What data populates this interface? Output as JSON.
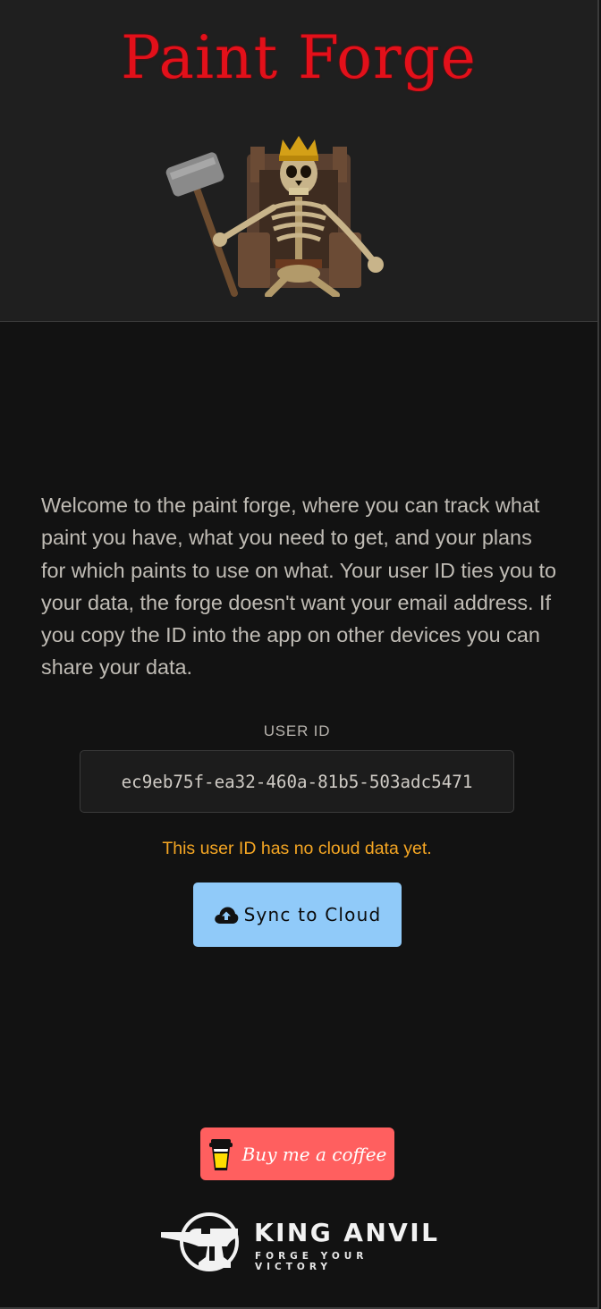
{
  "header": {
    "title": "Paint Forge",
    "hero_image": "crowned-skeleton-king-with-hammer"
  },
  "intro": {
    "text": "Welcome to the paint forge, where you can track what paint you have, what you need to get, and your plans for which paints to use on what. Your user ID ties you to your data, the forge doesn't want your email address. If you copy the ID into the app on other devices you can share your data."
  },
  "user_id": {
    "label": "USER ID",
    "value": "ec9eb75f-ea32-460a-81b5-503adc5471",
    "status": "This user ID has no cloud data yet."
  },
  "sync": {
    "label": "Sync to Cloud",
    "icon": "cloud-upload-icon",
    "color": "#90caf9"
  },
  "coffee": {
    "label": "Buy me a coffee",
    "icon": "coffee-cup-icon",
    "color": "#ff5f5f"
  },
  "brand": {
    "name": "KING ANVIL",
    "tagline": "FORGE YOUR VICTORY",
    "icon": "anvil-logo-icon"
  },
  "colors": {
    "title": "#e3101a",
    "status_warning": "#f5a623",
    "background": "#121212",
    "header_background": "#1f1f1f"
  }
}
